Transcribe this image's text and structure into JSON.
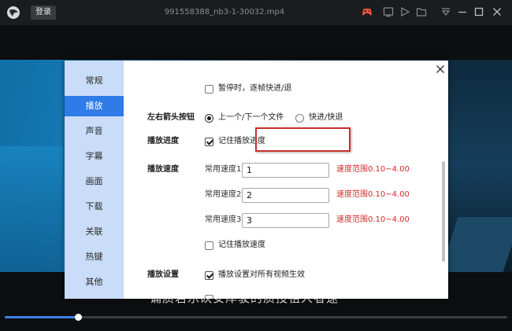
{
  "titlebar": {
    "login_label": "登录",
    "title": "991558388_nb3-1-30032.mp4",
    "icons": [
      "app-logo-icon",
      "gamepad-icon",
      "screen-icon",
      "play-list-icon",
      "folder-icon",
      "menu-arrow-icon",
      "minimize-icon",
      "maximize-icon",
      "close-icon"
    ],
    "gamepad_color": "#f2533d"
  },
  "video": {
    "subtitle": "诵质若乐砍安岸驶的质授祖人者速"
  },
  "progress": {
    "fraction": 0.145,
    "fill_color": "#3f7fe6"
  },
  "settings": {
    "nav": [
      {
        "label": "常规",
        "active": false
      },
      {
        "label": "播放",
        "active": true
      },
      {
        "label": "声音",
        "active": false
      },
      {
        "label": "字幕",
        "active": false
      },
      {
        "label": "画面",
        "active": false
      },
      {
        "label": "下载",
        "active": false
      },
      {
        "label": "关联",
        "active": false
      },
      {
        "label": "热键",
        "active": false
      },
      {
        "label": "其他",
        "active": false
      }
    ],
    "pause_step": {
      "label": "暂停时，逐帧快进/退",
      "checked": false
    },
    "arrow_keys": {
      "label": "左右箭头按钮",
      "options": [
        {
          "label": "上一个/下一个文件",
          "selected": true
        },
        {
          "label": "快进/快退",
          "selected": false
        }
      ]
    },
    "play_progress": {
      "label": "播放进度",
      "remember": {
        "label": "记住播放进度",
        "checked": true
      }
    },
    "play_speed": {
      "label": "播放速度",
      "speeds": [
        {
          "label": "常用速度1",
          "value": "1",
          "hint": "速度范围0.10~4.00"
        },
        {
          "label": "常用速度2",
          "value": "2",
          "hint": "速度范围0.10~4.00"
        },
        {
          "label": "常用速度3",
          "value": "3",
          "hint": "速度范围0.10~4.00"
        }
      ],
      "remember": {
        "label": "记住播放速度",
        "checked": false
      }
    },
    "play_settings": {
      "label": "播放设置",
      "apply_all": {
        "label": "播放设置对所有视频生效",
        "checked": true
      }
    },
    "highlight_color": "#c9302c",
    "active_nav_color": "#2f7be8",
    "hint_color": "#d12b2b"
  }
}
